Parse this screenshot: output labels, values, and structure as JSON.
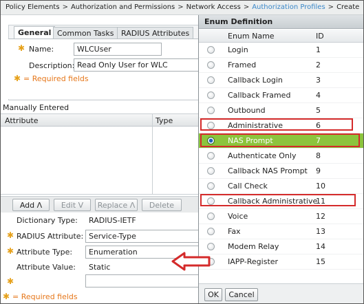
{
  "breadcrumb": {
    "items": [
      "Policy Elements",
      "Authorization and Permissions",
      "Network Access",
      "Authorization Profiles",
      "Create"
    ],
    "separator": ">"
  },
  "tabs": [
    {
      "label": "General",
      "active": true
    },
    {
      "label": "Common Tasks",
      "active": false
    },
    {
      "label": "RADIUS Attributes",
      "active": false
    }
  ],
  "general": {
    "name_label": "Name:",
    "name_value": "WLCUser",
    "description_label": "Description:",
    "description_value": "Read Only User for WLC",
    "required_note": "= Required fields"
  },
  "manual": {
    "title": "Manually Entered",
    "columns": [
      "Attribute",
      "Type"
    ]
  },
  "buttons": {
    "add": "Add Λ",
    "edit": "Edit V",
    "replace": "Replace Λ",
    "delete": "Delete"
  },
  "attribute_form": {
    "dictionary_type_label": "Dictionary Type:",
    "dictionary_type_value": "RADIUS-IETF",
    "radius_attribute_label": "RADIUS Attribute:",
    "radius_attribute_value": "Service-Type",
    "attribute_type_label": "Attribute Type:",
    "attribute_type_value": "Enumeration",
    "attribute_value_label": "Attribute Value:",
    "attribute_value_value": "Static",
    "enum_input_value": "",
    "required_note": "= Required fields"
  },
  "enum_dialog": {
    "title": "Enum Definition",
    "columns": [
      "Enum Name",
      "ID"
    ],
    "rows": [
      {
        "name": "Login",
        "id": "1"
      },
      {
        "name": "Framed",
        "id": "2"
      },
      {
        "name": "Callback Login",
        "id": "3"
      },
      {
        "name": "Callback Framed",
        "id": "4"
      },
      {
        "name": "Outbound",
        "id": "5"
      },
      {
        "name": "Administrative",
        "id": "6"
      },
      {
        "name": "NAS Prompt",
        "id": "7"
      },
      {
        "name": "Authenticate Only",
        "id": "8"
      },
      {
        "name": "Callback NAS Prompt",
        "id": "9"
      },
      {
        "name": "Call Check",
        "id": "10"
      },
      {
        "name": "Callback Administrative",
        "id": "11"
      },
      {
        "name": "Voice",
        "id": "12"
      },
      {
        "name": "Fax",
        "id": "13"
      },
      {
        "name": "Modem Relay",
        "id": "14"
      },
      {
        "name": "IAPP-Register",
        "id": "15"
      }
    ],
    "ok_label": "OK",
    "cancel_label": "Cancel"
  },
  "colors": {
    "accent_link": "#3a87c8",
    "selected_row": "#8cc43d",
    "highlight_red": "#d42a2a",
    "required_orange": "#e6771a"
  },
  "icons": {
    "required": "asterisk-icon",
    "radio": "radio-button-icon",
    "pointer": "red-arrow-icon"
  }
}
